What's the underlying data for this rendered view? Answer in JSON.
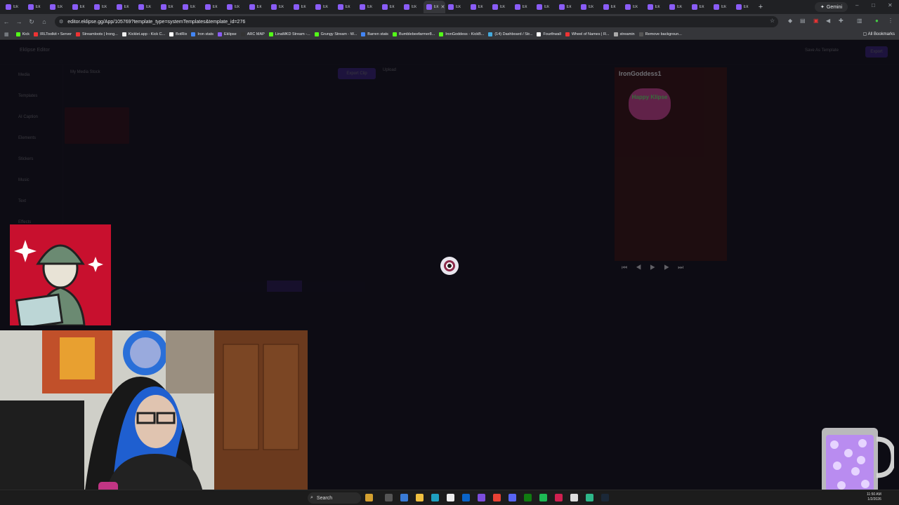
{
  "browser": {
    "tab_label": "Ek",
    "tab_count": 34,
    "active_tab_index": 19,
    "gemini_label": "Gemini",
    "url": "editor.eklipse.gg/App/105769?template_type=systemTemplates&template_id=276"
  },
  "bookmarks": [
    {
      "label": "Kick",
      "color": "#53fc18"
    },
    {
      "label": "IRLToolkit • Server",
      "color": "#e33"
    },
    {
      "label": "Streamloots | Irong...",
      "color": "#e33"
    },
    {
      "label": "Kicklet.app - Kick C...",
      "color": "#eee"
    },
    {
      "label": "BotRix",
      "color": "#fff"
    },
    {
      "label": "Iron stats",
      "color": "#4285f4"
    },
    {
      "label": "Eklipse",
      "color": "#8a5cf6"
    },
    {
      "label": "ARC MAP",
      "color": "#333"
    },
    {
      "label": "LinaMKD Stream -...",
      "color": "#53fc18"
    },
    {
      "label": "Grungy Stream - W...",
      "color": "#53fc18"
    },
    {
      "label": "Barren stats",
      "color": "#4285f4"
    },
    {
      "label": "Bumblebeefarmer8...",
      "color": "#53fc18"
    },
    {
      "label": "IronGoddess - KickB...",
      "color": "#53fc18"
    },
    {
      "label": "(14) Dashboard / Str...",
      "color": "#4ad"
    },
    {
      "label": "Fourthwall",
      "color": "#fff"
    },
    {
      "label": "Wheel of Names | R...",
      "color": "#e33"
    },
    {
      "label": "streamin",
      "color": "#aaa"
    },
    {
      "label": "Remove backgroun...",
      "color": "#555"
    }
  ],
  "all_bookmarks_label": "All Bookmarks",
  "editor": {
    "app_name": "Eklipse Editor",
    "sidebar_items": [
      "Media",
      "Templates",
      "AI Caption",
      "Elements",
      "Stickers",
      "Music",
      "Text",
      "Effects"
    ],
    "clip_tabs": "My Media   Stock",
    "export_clip_label": "Export Clip",
    "upload_label": "Upload",
    "export_label": "Export",
    "save_template_label": "Save As Template",
    "preview_title": "IronGoddess1",
    "preview_badge": "Happy Klipse",
    "loading_state": "loading"
  },
  "taskbar": {
    "search_label": "Search",
    "time": "11:50 AM",
    "date": "1/2/2026"
  }
}
